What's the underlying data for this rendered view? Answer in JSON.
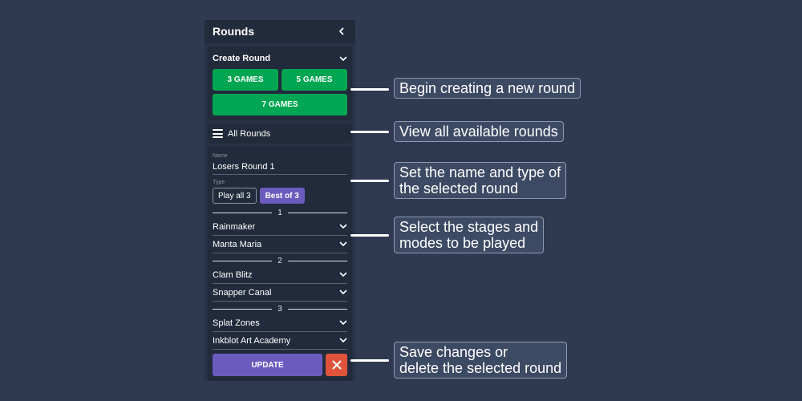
{
  "panel": {
    "title": "Rounds",
    "back_icon": "chevron-left-icon"
  },
  "create": {
    "label": "Create Round",
    "buttons": [
      "3 GAMES",
      "5 GAMES",
      "7 GAMES"
    ],
    "colors": {
      "green": "#00a651"
    }
  },
  "all_rounds": {
    "label": "All Rounds",
    "icon": "menu-icon"
  },
  "editor": {
    "name_label": "Name",
    "name_value": "Losers Round 1",
    "type_label": "Type",
    "type_options": [
      "Play all 3",
      "Best of 3"
    ],
    "type_selected": "Best of 3",
    "games": [
      {
        "number": "1",
        "mode": "Rainmaker",
        "stage": "Manta Maria"
      },
      {
        "number": "2",
        "mode": "Clam Blitz",
        "stage": "Snapper Canal"
      },
      {
        "number": "3",
        "mode": "Splat Zones",
        "stage": "Inkblot Art Academy"
      }
    ],
    "update_label": "UPDATE",
    "colors": {
      "purple": "#6b5bbf",
      "red": "#e0533b"
    }
  },
  "callouts": {
    "create": "Begin creating a new round",
    "all": "View all available rounds",
    "name_type_1": "Set the name and type of",
    "name_type_2": "the selected round",
    "stages_1": "Select the stages and",
    "stages_2": "modes to be played",
    "save_1": "Save changes or",
    "save_2": "delete the selected round"
  }
}
